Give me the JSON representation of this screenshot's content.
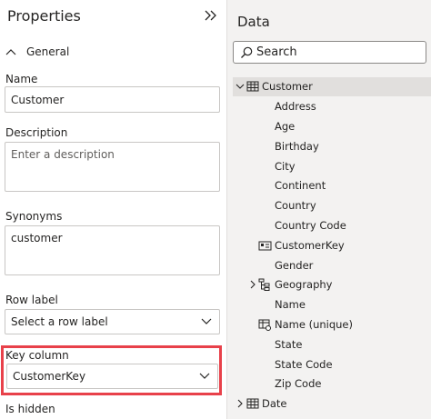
{
  "properties": {
    "title": "Properties",
    "section_label": "General",
    "name_label": "Name",
    "name_value": "Customer",
    "description_label": "Description",
    "description_placeholder": "Enter a description",
    "synonyms_label": "Synonyms",
    "synonyms_value": "customer",
    "row_label_label": "Row label",
    "row_label_value": "Select a row label",
    "key_column_label": "Key column",
    "key_column_value": "CustomerKey",
    "is_hidden_label": "Is hidden"
  },
  "data_pane": {
    "title": "Data",
    "search_placeholder": "Search",
    "tree": [
      {
        "label": "Customer",
        "type": "table",
        "expanded": true,
        "selected": true
      },
      {
        "label": "Address",
        "type": "field"
      },
      {
        "label": "Age",
        "type": "field"
      },
      {
        "label": "Birthday",
        "type": "field"
      },
      {
        "label": "City",
        "type": "field"
      },
      {
        "label": "Continent",
        "type": "field"
      },
      {
        "label": "Country",
        "type": "field"
      },
      {
        "label": "Country Code",
        "type": "field"
      },
      {
        "label": "CustomerKey",
        "type": "key-field",
        "icon": "id-card-icon"
      },
      {
        "label": "Gender",
        "type": "field"
      },
      {
        "label": "Geography",
        "type": "hierarchy",
        "expanded": false,
        "icon": "hierarchy-icon"
      },
      {
        "label": "Name",
        "type": "field"
      },
      {
        "label": "Name (unique)",
        "type": "field",
        "icon": "unique-table-icon"
      },
      {
        "label": "State",
        "type": "field"
      },
      {
        "label": "State Code",
        "type": "field"
      },
      {
        "label": "Zip Code",
        "type": "field"
      },
      {
        "label": "Date",
        "type": "table",
        "expanded": false
      }
    ]
  },
  "colors": {
    "highlight": "#e8414a",
    "pane_background": "#f3f2f1",
    "selected_row": "#e1dfdd"
  }
}
